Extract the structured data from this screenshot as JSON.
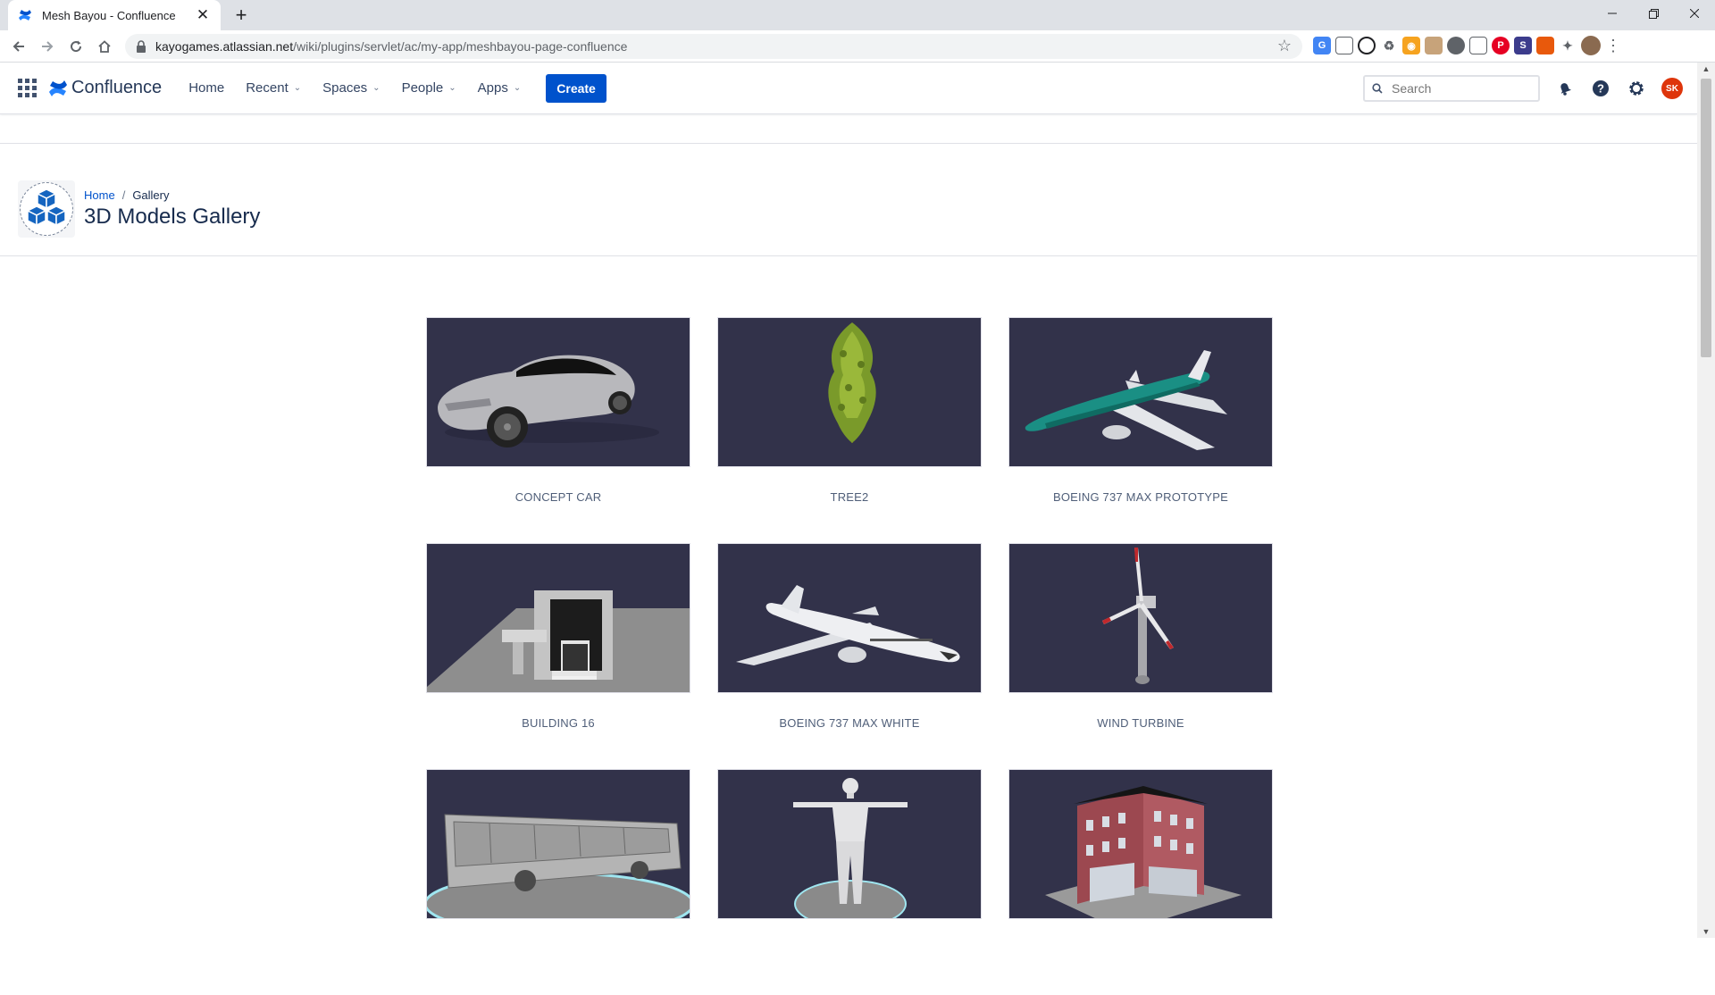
{
  "browser": {
    "tab_title": "Mesh Bayou - Confluence",
    "url_host": "kayogames.atlassian.net",
    "url_path": "/wiki/plugins/servlet/ac/my-app/meshbayou-page-confluence",
    "new_tab_label": "+",
    "close_label": "✕"
  },
  "header": {
    "logo_text": "Confluence",
    "nav": [
      {
        "label": "Home"
      },
      {
        "label": "Recent"
      },
      {
        "label": "Spaces"
      },
      {
        "label": "People"
      },
      {
        "label": "Apps"
      }
    ],
    "create_label": "Create",
    "search_placeholder": "Search",
    "avatar_initials": "SK"
  },
  "page": {
    "breadcrumb_home": "Home",
    "breadcrumb_sep": "/",
    "breadcrumb_current": "Gallery",
    "title": "3D Models Gallery"
  },
  "gallery": {
    "items": [
      {
        "caption": "CONCEPT CAR"
      },
      {
        "caption": "TREE2"
      },
      {
        "caption": "BOEING 737 MAX PROTOTYPE"
      },
      {
        "caption": "BUILDING 16"
      },
      {
        "caption": "BOEING 737 MAX WHITE"
      },
      {
        "caption": "WIND TURBINE"
      },
      {
        "caption": ""
      },
      {
        "caption": ""
      },
      {
        "caption": ""
      }
    ]
  },
  "colors": {
    "brand": "#0052cc",
    "thumb_bg": "#32324a",
    "avatar": "#de350b"
  }
}
